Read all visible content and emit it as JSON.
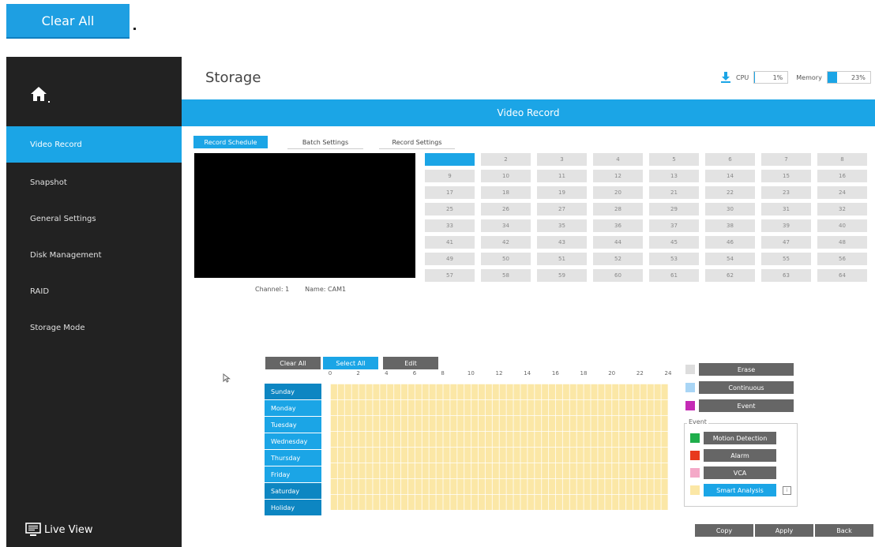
{
  "top_button": {
    "label": "Clear All"
  },
  "header": {
    "title": "Storage",
    "cpu_label": "CPU",
    "cpu_value": "1%",
    "cpu_fraction": 0.01,
    "memory_label": "Memory",
    "memory_value": "23%",
    "memory_fraction": 0.23
  },
  "sidebar": {
    "items": [
      {
        "label": "Video Record",
        "active": true
      },
      {
        "label": "Snapshot"
      },
      {
        "label": "General Settings"
      },
      {
        "label": "Disk Management"
      },
      {
        "label": "RAID"
      },
      {
        "label": "Storage Mode"
      }
    ],
    "live_view": "Live View"
  },
  "section_title": "Video Record",
  "tabs": [
    {
      "label": "Record Schedule",
      "active": true
    },
    {
      "label": "Batch Settings"
    },
    {
      "label": "Record Settings"
    }
  ],
  "channel_info": {
    "channel": "Channel: 1",
    "name": "Name: CAM1"
  },
  "channels": [
    "1",
    "2",
    "3",
    "4",
    "5",
    "6",
    "7",
    "8",
    "9",
    "10",
    "11",
    "12",
    "13",
    "14",
    "15",
    "16",
    "17",
    "18",
    "19",
    "20",
    "21",
    "22",
    "23",
    "24",
    "25",
    "26",
    "27",
    "28",
    "29",
    "30",
    "31",
    "32",
    "33",
    "34",
    "35",
    "36",
    "37",
    "38",
    "39",
    "40",
    "41",
    "42",
    "43",
    "44",
    "45",
    "46",
    "47",
    "48",
    "49",
    "50",
    "51",
    "52",
    "53",
    "54",
    "55",
    "56",
    "57",
    "58",
    "59",
    "60",
    "61",
    "62",
    "63",
    "64"
  ],
  "selected_channel": "1",
  "schedule": {
    "clear_all": "Clear All",
    "select_all": "Select All",
    "edit": "Edit",
    "hours": [
      "0",
      "2",
      "4",
      "6",
      "8",
      "10",
      "12",
      "14",
      "16",
      "18",
      "20",
      "22",
      "24"
    ],
    "days": [
      "Sunday",
      "Monday",
      "Tuesday",
      "Wednesday",
      "Thursday",
      "Friday",
      "Saturday",
      "Holiday"
    ]
  },
  "legend": {
    "erase": "Erase",
    "continuous": "Continuous",
    "event": "Event",
    "event_group": "Event",
    "motion": "Motion Detection",
    "alarm": "Alarm",
    "vca": "VCA",
    "smart": "Smart Analysis",
    "colors": {
      "erase": "#dddddd",
      "continuous": "#a9d5f5",
      "event": "#c42bb5",
      "motion": "#1fae4b",
      "alarm": "#e8391d",
      "vca": "#f4a9c8",
      "smart": "#fbe7a6"
    }
  },
  "footer": {
    "copy": "Copy",
    "apply": "Apply",
    "back": "Back"
  },
  "colors": {
    "accent": "#1ba5e6",
    "sidebar": "#222222"
  }
}
